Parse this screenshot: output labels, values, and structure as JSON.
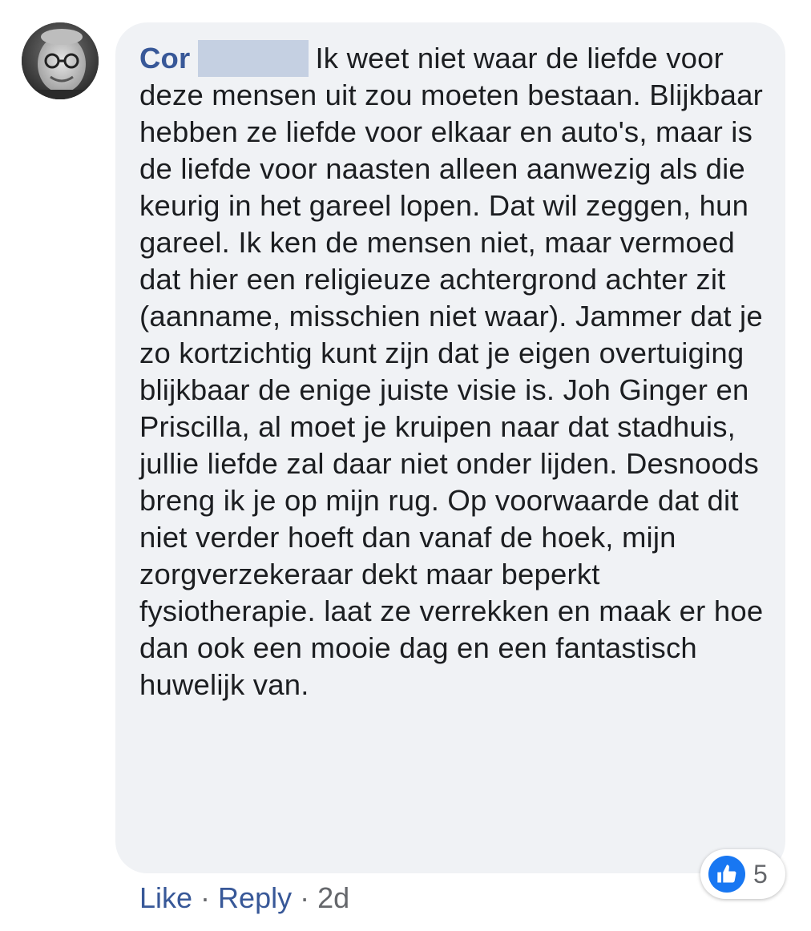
{
  "comment": {
    "author": "Cor",
    "text": "Ik weet niet waar de liefde voor deze mensen uit zou moeten bestaan. Blijkbaar hebben ze liefde voor elkaar en auto's, maar is de liefde voor naasten alleen aanwezig als die keurig in het gareel lopen. Dat wil zeggen, hun gareel. Ik ken de mensen niet, maar vermoed dat hier een religieuze achtergrond achter zit (aanname, misschien niet waar). Jammer dat je zo kortzichtig kunt zijn dat je eigen overtuiging blijkbaar de enige juiste visie is. Joh Ginger en Priscilla, al moet je kruipen naar dat stadhuis, jullie liefde zal daar niet onder lijden. Desnoods breng ik je op mijn rug. Op voorwaarde dat dit niet verder hoeft dan vanaf de hoek, mijn zorgverzekeraar dekt maar beperkt fysiotherapie. laat ze verrekken en maak er hoe dan ook een mooie dag en een fantastisch huwelijk van."
  },
  "reactions": {
    "icon": "like-thumb-icon",
    "count": "5"
  },
  "actions": {
    "like_label": "Like",
    "reply_label": "Reply",
    "separator": "·",
    "timestamp": "2d"
  },
  "colors": {
    "author": "#385898",
    "bubble": "#f0f2f5",
    "like_blue": "#1877f2",
    "redaction": "#c5d0e2"
  }
}
